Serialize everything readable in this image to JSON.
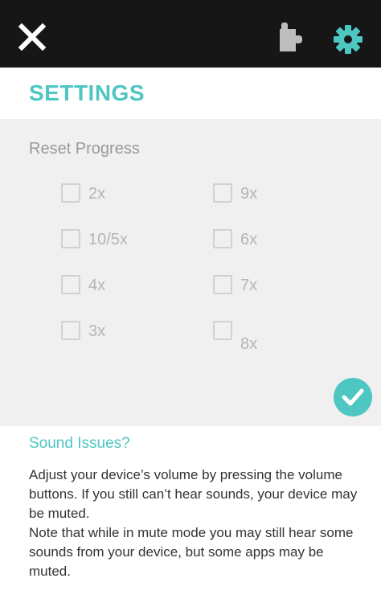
{
  "header": {
    "close_icon": "close-icon",
    "puzzle_icon": "puzzle-icon",
    "gear_icon": "gear-icon",
    "accent_color": "#4ec6c2",
    "bar_color": "#161616"
  },
  "page": {
    "title": "SETTINGS"
  },
  "reset_progress": {
    "heading": "Reset Progress",
    "options": [
      {
        "label": "2x",
        "checked": false
      },
      {
        "label": "10/5x",
        "checked": false
      },
      {
        "label": "4x",
        "checked": false
      },
      {
        "label": "3x",
        "checked": false
      },
      {
        "label": "9x",
        "checked": false
      },
      {
        "label": "6x",
        "checked": false
      },
      {
        "label": "7x",
        "checked": false
      },
      {
        "label": "8x",
        "checked": false
      }
    ],
    "confirm_icon": "check-icon"
  },
  "sound": {
    "heading": "Sound Issues?",
    "paragraph_1": "Adjust your device’s volume by pressing the volume buttons. If you still can’t hear sounds, your device may be muted.",
    "paragraph_2": "Note that while in mute mode you may still hear some sounds from your device, but some apps may be muted."
  }
}
